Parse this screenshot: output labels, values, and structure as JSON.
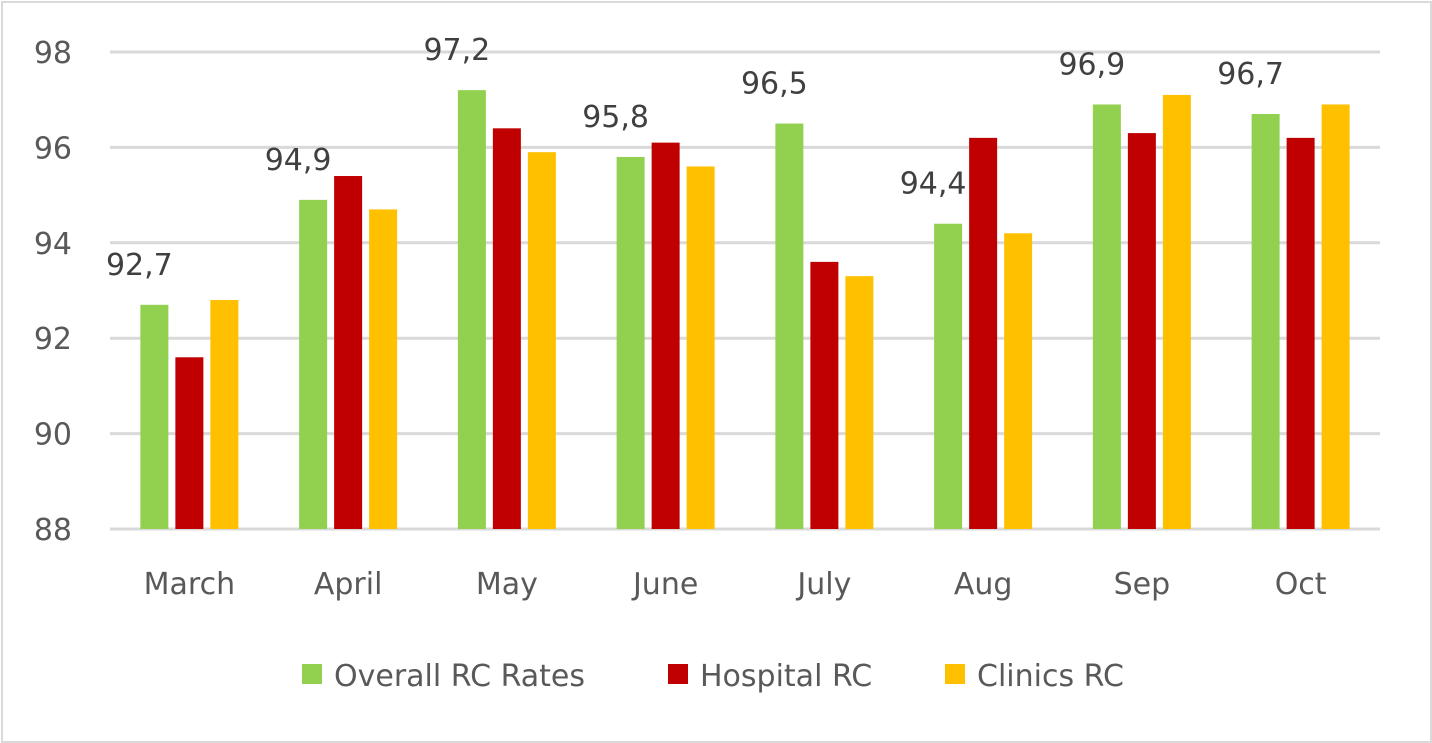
{
  "chart_data": {
    "type": "bar",
    "title": "",
    "xlabel": "",
    "ylabel": "",
    "ylim": [
      88,
      98
    ],
    "yticks": [
      88,
      90,
      92,
      94,
      96,
      98
    ],
    "grid": true,
    "legend_position": "bottom",
    "categories": [
      "March",
      "April",
      "May",
      "June",
      "July",
      "Aug",
      "Sep",
      "Oct"
    ],
    "series": [
      {
        "name": "Overall RC Rates",
        "color": "#92d050",
        "values": [
          92.7,
          94.9,
          97.2,
          95.8,
          96.5,
          94.4,
          96.9,
          96.7
        ],
        "data_labels": [
          "92,7",
          "94,9",
          "97,2",
          "95,8",
          "96,5",
          "94,4",
          "96,9",
          "96,7"
        ]
      },
      {
        "name": "Hospital RC",
        "color": "#c00000",
        "values": [
          91.6,
          95.4,
          96.4,
          96.1,
          93.6,
          96.2,
          96.3,
          96.2
        ]
      },
      {
        "name": "Clinics RC",
        "color": "#ffc000",
        "values": [
          92.8,
          94.7,
          95.9,
          95.6,
          93.3,
          94.2,
          97.1,
          96.9
        ]
      }
    ]
  }
}
